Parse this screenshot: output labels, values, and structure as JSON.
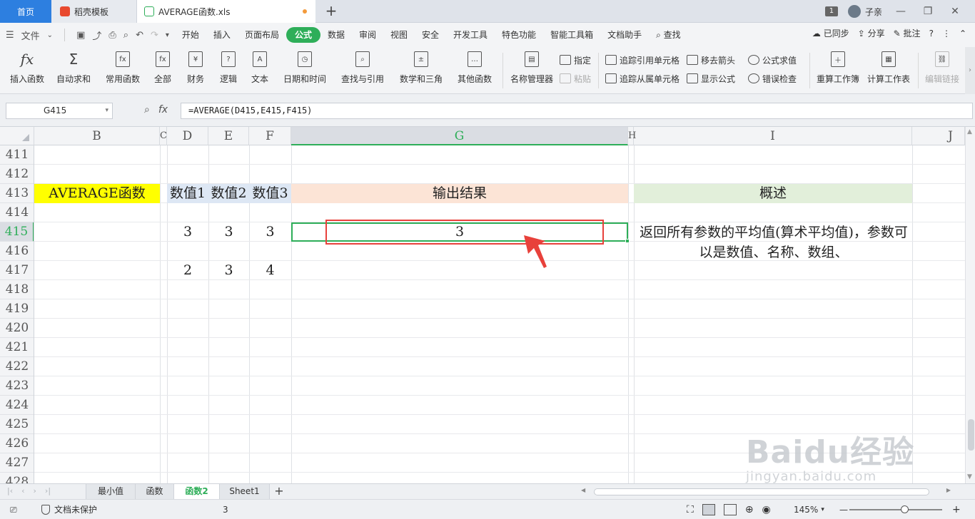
{
  "tabs": {
    "home": "首页",
    "template": "稻壳模板",
    "file": "AVERAGE函数.xls"
  },
  "window": {
    "badge": "1",
    "user": "子亲"
  },
  "menu": {
    "file": "文件",
    "items": [
      "开始",
      "插入",
      "页面布局",
      "公式",
      "数据",
      "审阅",
      "视图",
      "安全",
      "开发工具",
      "特色功能",
      "智能工具箱",
      "文档助手"
    ],
    "active_index": 3,
    "search": "查找",
    "synced": "已同步",
    "share": "分享",
    "annotate": "批注"
  },
  "ribbon": {
    "insert_function": "插入函数",
    "autosum": "自动求和",
    "common": "常用函数",
    "all": "全部",
    "finance": "财务",
    "logic": "逻辑",
    "text": "文本",
    "datetime": "日期和时间",
    "lookup": "查找与引用",
    "math": "数学和三角",
    "other": "其他函数",
    "name_manager": "名称管理器",
    "assign": "指定",
    "paste": "粘贴",
    "trace_precedents": "追踪引用单元格",
    "trace_dependents": "追踪从属单元格",
    "remove_arrows": "移去箭头",
    "show_formulas": "显示公式",
    "eval_formula": "公式求值",
    "error_check": "错误检查",
    "recalc_workbook": "重算工作簿",
    "calc_sheet": "计算工作表",
    "edit_links": "编辑链接"
  },
  "formula_bar": {
    "cell_ref": "G415",
    "fx": "fx",
    "formula": "=AVERAGE(D415,E415,F415)"
  },
  "columns": [
    "B",
    "C",
    "D",
    "E",
    "F",
    "G",
    "H",
    "I",
    "J"
  ],
  "rows": [
    "411",
    "412",
    "413",
    "414",
    "415",
    "416",
    "417",
    "418",
    "419",
    "420",
    "421",
    "422",
    "423",
    "424",
    "425",
    "426",
    "427",
    "428"
  ],
  "cells": {
    "b413": "AVERAGE函数",
    "d413": "数值1",
    "e413": "数值2",
    "f413": "数值3",
    "g413": "输出结果",
    "i413": "概述",
    "d415": "3",
    "e415": "3",
    "f415": "3",
    "g415": "3",
    "d417": "2",
    "e417": "3",
    "f417": "4",
    "i415": "返回所有参数的平均值(算术平均值)，参数可以是数值、名称、数组、"
  },
  "sheets": {
    "tabs": [
      "最小值",
      "函数",
      "函数2",
      "Sheet1"
    ],
    "active_index": 2
  },
  "status": {
    "protect": "文档未保护",
    "value": "3",
    "zoom": "145%"
  },
  "watermark": {
    "line1": "Baidu经验",
    "line2": "jingyan.baidu.com"
  },
  "colors": {
    "accent": "#2eae59",
    "highlight_yellow": "#ffff00",
    "header_peach": "#fce4d6",
    "header_green": "#e2efda",
    "annotation_red": "#e8413b"
  }
}
